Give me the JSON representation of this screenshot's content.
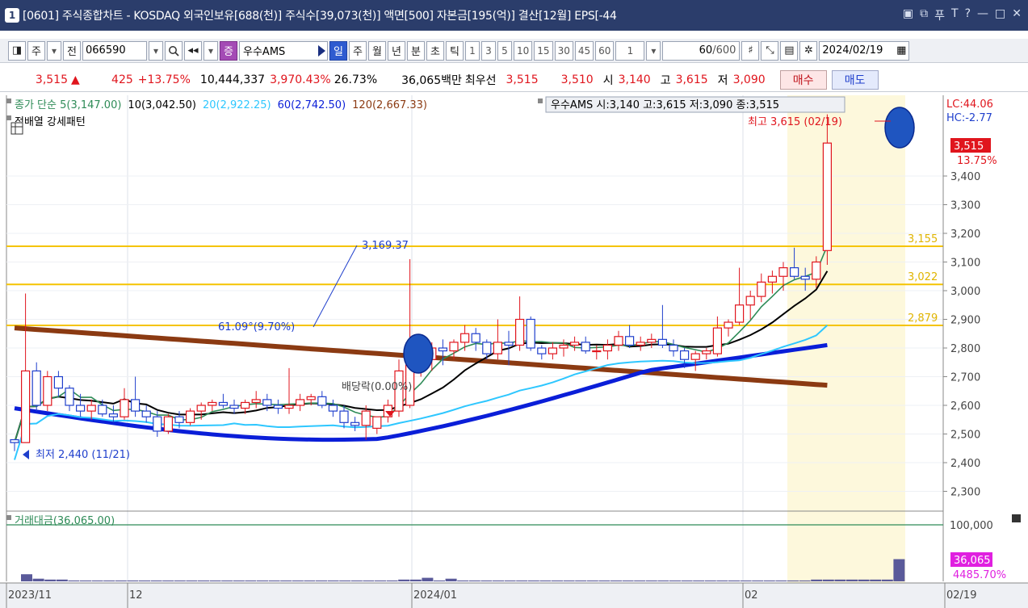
{
  "window": {
    "number": "1",
    "title": "[0601] 주식종합차트 - KOSDAQ 외국인보유[688(천)] 주식수[39,073(천)] 액면[500] 자본금[195(억)] 결산[12월] EPS[-44"
  },
  "toolbar": {
    "btn_ju": "주",
    "btn_jeon": "전",
    "code": "066590",
    "search_icon": "search-icon",
    "badge_jeung": "증",
    "stock_name": "우수AMS",
    "periods": [
      "일",
      "주",
      "월",
      "년",
      "분",
      "초",
      "틱"
    ],
    "intervals": [
      "1",
      "3",
      "5",
      "10",
      "15",
      "30",
      "45",
      "60"
    ],
    "interval_value": "1",
    "count": "60",
    "count_total": "/600",
    "date": "2024/02/19"
  },
  "price": {
    "current": "3,515",
    "change": "425",
    "change_pct": "+13.75%",
    "volume": "10,444,337",
    "vol_ratio": "3,970.43%",
    "turnover": "26.73%",
    "amount": "36,065백만",
    "best_label": "최우선",
    "ask": "3,515",
    "bid": "3,510",
    "open_label": "시",
    "open": "3,140",
    "high_label": "고",
    "high": "3,615",
    "low_label": "저",
    "low": "3,090",
    "buy": "매수",
    "sell": "매도"
  },
  "legend": {
    "ma5": "종가 단순 5(3,147.00)",
    "ma10": "10(3,042.50)",
    "ma20": "20(2,922.25)",
    "ma60": "60(2,742.50)",
    "ma120": "120(2,667.33)",
    "ohlc": "우수AMS 시:3,140 고:3,615 저:3,090 종:3,515",
    "pattern": "정배열 강세패턴",
    "lc": "LC:44.06",
    "hc": "HC:-2.77"
  },
  "annotations": {
    "high": "최고 3,615 (02/19)",
    "low": "최저 2,440 (11/21)",
    "fib_price": "3,169.37",
    "fib_pct": "61.09°(9.70%)",
    "dividend": "배당락(0.00%)"
  },
  "volume_panel": {
    "label": "거래대금(36,065.00)",
    "axis_label": "100,000",
    "current": "36,065",
    "pct": "4485.70%"
  },
  "colors": {
    "up": "#e0151d",
    "down": "#1f3fcc",
    "ma5": "#2e8b57",
    "ma10": "#000000",
    "ma20": "#2ec7ff",
    "ma60": "#0a1ed8",
    "ma120": "#8b3a12",
    "hline": "#f5c400"
  },
  "chart_data": {
    "type": "candlestick",
    "x_labels": [
      "2023/11",
      "12",
      "2024/01",
      "02",
      "02/19"
    ],
    "y_ticks": [
      2300,
      2400,
      2500,
      2600,
      2700,
      2800,
      2900,
      3000,
      3100,
      3200,
      3300,
      3400
    ],
    "ylim": [
      2230,
      3700
    ],
    "horizontal_lines": [
      {
        "value": 3155,
        "label": "3,155"
      },
      {
        "value": 3022,
        "label": "3,022"
      },
      {
        "value": 2879,
        "label": "2,879"
      }
    ],
    "last_price": {
      "value": 3515,
      "label": "3,515",
      "pct": "13.75%"
    },
    "candles": [
      [
        2480,
        2480,
        2440,
        2470
      ],
      [
        2470,
        2990,
        2470,
        2720
      ],
      [
        2720,
        2750,
        2580,
        2600
      ],
      [
        2600,
        2720,
        2580,
        2700
      ],
      [
        2700,
        2720,
        2630,
        2660
      ],
      [
        2660,
        2670,
        2580,
        2600
      ],
      [
        2600,
        2640,
        2560,
        2580
      ],
      [
        2580,
        2620,
        2550,
        2600
      ],
      [
        2600,
        2620,
        2560,
        2570
      ],
      [
        2570,
        2600,
        2540,
        2560
      ],
      [
        2560,
        2660,
        2550,
        2620
      ],
      [
        2620,
        2700,
        2560,
        2580
      ],
      [
        2580,
        2600,
        2540,
        2560
      ],
      [
        2560,
        2580,
        2490,
        2510
      ],
      [
        2510,
        2570,
        2500,
        2560
      ],
      [
        2560,
        2580,
        2520,
        2540
      ],
      [
        2540,
        2590,
        2530,
        2580
      ],
      [
        2580,
        2610,
        2550,
        2600
      ],
      [
        2600,
        2620,
        2580,
        2610
      ],
      [
        2610,
        2640,
        2590,
        2600
      ],
      [
        2600,
        2620,
        2570,
        2590
      ],
      [
        2590,
        2620,
        2570,
        2610
      ],
      [
        2610,
        2650,
        2590,
        2620
      ],
      [
        2620,
        2640,
        2580,
        2600
      ],
      [
        2600,
        2620,
        2570,
        2590
      ],
      [
        2590,
        2730,
        2570,
        2600
      ],
      [
        2600,
        2640,
        2580,
        2620
      ],
      [
        2620,
        2640,
        2600,
        2630
      ],
      [
        2630,
        2650,
        2590,
        2600
      ],
      [
        2600,
        2620,
        2560,
        2580
      ],
      [
        2580,
        2600,
        2520,
        2540
      ],
      [
        2540,
        2560,
        2510,
        2530
      ],
      [
        2530,
        2600,
        2480,
        2580
      ],
      [
        2520,
        2560,
        2500,
        2560
      ],
      [
        2560,
        2620,
        2540,
        2600
      ],
      [
        2580,
        2760,
        2560,
        2720
      ],
      [
        2600,
        3110,
        2590,
        2740
      ],
      [
        2740,
        2800,
        2700,
        2760
      ],
      [
        2760,
        2820,
        2720,
        2800
      ],
      [
        2800,
        2830,
        2740,
        2790
      ],
      [
        2790,
        2830,
        2760,
        2820
      ],
      [
        2820,
        2880,
        2790,
        2850
      ],
      [
        2850,
        2870,
        2790,
        2820
      ],
      [
        2820,
        2830,
        2760,
        2780
      ],
      [
        2780,
        2900,
        2760,
        2820
      ],
      [
        2820,
        2860,
        2740,
        2810
      ],
      [
        2810,
        2980,
        2790,
        2900
      ],
      [
        2900,
        2910,
        2790,
        2800
      ]
    ],
    "candles_b": [
      [
        2800,
        2810,
        2760,
        2780
      ],
      [
        2780,
        2820,
        2760,
        2800
      ],
      [
        2800,
        2830,
        2770,
        2810
      ],
      [
        2810,
        2840,
        2790,
        2820
      ],
      [
        2820,
        2840,
        2780,
        2790
      ],
      [
        2790,
        2810,
        2760,
        2790
      ],
      [
        2790,
        2830,
        2760,
        2810
      ],
      [
        2810,
        2860,
        2790,
        2840
      ],
      [
        2840,
        2880,
        2800,
        2810
      ],
      [
        2810,
        2840,
        2790,
        2820
      ],
      [
        2820,
        2850,
        2800,
        2830
      ],
      [
        2830,
        2950,
        2800,
        2810
      ],
      [
        2810,
        2830,
        2770,
        2790
      ],
      [
        2790,
        2800,
        2730,
        2760
      ],
      [
        2760,
        2790,
        2720,
        2780
      ],
      [
        2780,
        2800,
        2760,
        2790
      ],
      [
        2780,
        2910,
        2770,
        2870
      ],
      [
        2870,
        2900,
        2840,
        2890
      ],
      [
        2890,
        3080,
        2880,
        2950
      ],
      [
        2950,
        3000,
        2900,
        2980
      ],
      [
        2980,
        3060,
        2960,
        3030
      ],
      [
        3030,
        3070,
        2990,
        3050
      ],
      [
        3050,
        3100,
        3000,
        3080
      ],
      [
        3080,
        3150,
        3040,
        3050
      ],
      [
        3050,
        3080,
        3000,
        3040
      ],
      [
        3040,
        3120,
        3010,
        3100
      ],
      [
        3140,
        3615,
        3090,
        3515
      ]
    ],
    "volumes": [
      8,
      3,
      2,
      2,
      1,
      1,
      1,
      1,
      1,
      1,
      1,
      1,
      1,
      1,
      1,
      1,
      1,
      1,
      1,
      1,
      1,
      1,
      1,
      1,
      1,
      1,
      1,
      1,
      1,
      1,
      1,
      1,
      2,
      2,
      4,
      1,
      3,
      1,
      1,
      1,
      1,
      1,
      1,
      1,
      1,
      1,
      1,
      1,
      1,
      1,
      1,
      1,
      1,
      1,
      1,
      1,
      1,
      1,
      1,
      1,
      1,
      1,
      1,
      1,
      1,
      1,
      1,
      2,
      2,
      2,
      2,
      2,
      2,
      2,
      25
    ]
  }
}
